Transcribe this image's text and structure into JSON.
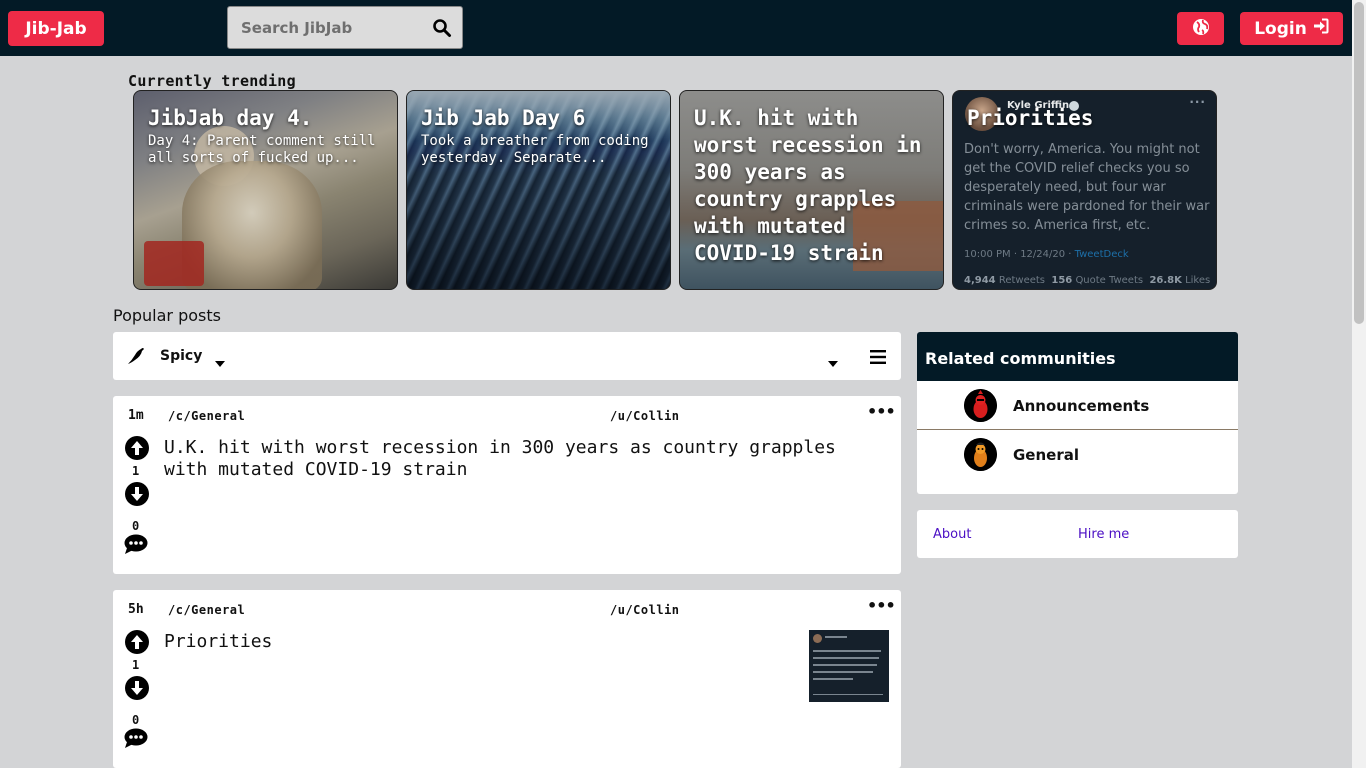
{
  "header": {
    "logo": "Jib-Jab",
    "search_placeholder": "Search JibJab",
    "login_label": "Login"
  },
  "trending": {
    "title": "Currently trending",
    "cards": [
      {
        "title": "JibJab day 4.",
        "desc": "Day 4: Parent comment still all sorts of fucked up..."
      },
      {
        "title": "Jib Jab Day 6",
        "desc": "Took a breather from coding yesterday. Separate..."
      },
      {
        "title": "U.K. hit with worst recession in 300 years as country grapples with mutated COVID-19 strain",
        "desc": ""
      },
      {
        "title": "Priorities",
        "desc": "",
        "tweet": {
          "author": "Kyle Griffin",
          "text": "Don't worry, America. You might not get the COVID relief checks you so desperately need, but four war criminals were pardoned for their war crimes so. America first, etc.",
          "time": "10:00 PM · 12/24/20 · ",
          "source": "TweetDeck",
          "retweets": "4,944",
          "retweets_label": "Retweets",
          "quotes": "156",
          "quotes_label": "Quote Tweets",
          "likes": "26.8K",
          "likes_label": "Likes"
        }
      }
    ]
  },
  "popular": {
    "title": "Popular posts",
    "sort_label": "Spicy"
  },
  "posts": [
    {
      "age": "1m",
      "community": "/c/General",
      "user": "/u/Collin",
      "votes": "1",
      "comments": "0",
      "title": "U.K. hit with worst recession in 300 years as country grapples with mutated COVID-19 strain"
    },
    {
      "age": "5h",
      "community": "/c/General",
      "user": "/u/Collin",
      "votes": "1",
      "comments": "0",
      "title": "Priorities"
    }
  ],
  "sidebar": {
    "related_title": "Related communities",
    "communities": [
      {
        "name": "Announcements"
      },
      {
        "name": "General"
      }
    ],
    "links": {
      "about": "About",
      "hire": "Hire me"
    }
  },
  "colors": {
    "accent": "#ee2b47",
    "navbar": "#031a26",
    "background": "#d3d4d6",
    "link": "#4b0fc4"
  }
}
